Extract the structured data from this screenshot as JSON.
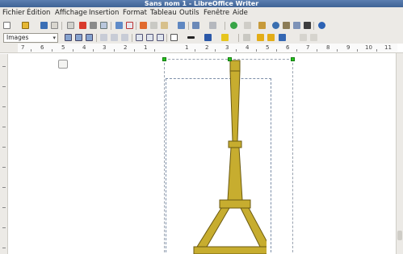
{
  "window": {
    "title": "Sans nom 1 - LibreOffice Writer"
  },
  "menu": {
    "items": [
      "Fichier",
      "Édition",
      "Affichage",
      "Insertion",
      "Format",
      "Tableau",
      "Outils",
      "Fenêtre",
      "Aide"
    ]
  },
  "format_toolbar": {
    "paragraph_style": "Images"
  },
  "ruler": {
    "labels": [
      "7",
      "6",
      "5",
      "4",
      "3",
      "2",
      "1",
      "1",
      "2",
      "3",
      "4",
      "5",
      "6",
      "7",
      "8",
      "9",
      "10",
      "11"
    ]
  },
  "colors": {
    "accent": "#5c7fb0",
    "tower_fill": "#c7ad2f",
    "tower_stroke": "#6b5a10",
    "handle": "#27c21f"
  },
  "document": {
    "content": "Eiffel tower drawing selected"
  }
}
